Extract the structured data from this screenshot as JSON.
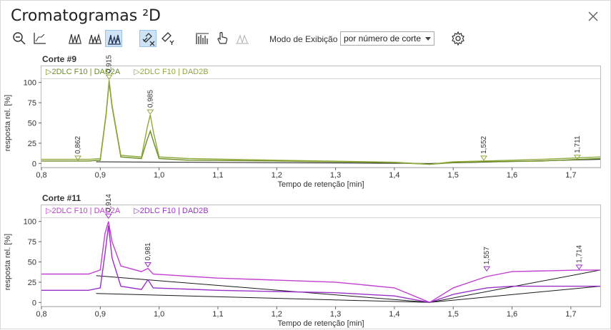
{
  "window": {
    "title": "Cromatogramas ²D"
  },
  "toolbar": {
    "mode_label": "Modo de Exibição",
    "mode_value": "por número de corte",
    "buttons": [
      {
        "name": "zoom-out-icon"
      },
      {
        "name": "axis-icon"
      },
      {
        "name": "peaks-icon"
      },
      {
        "name": "peaks-alt-icon"
      },
      {
        "name": "peaks-overlay-icon",
        "active": true
      },
      {
        "name": "link-x-icon",
        "active": true
      },
      {
        "name": "link-y-icon"
      },
      {
        "name": "spectrum-icon"
      },
      {
        "name": "hand-pointer-icon"
      },
      {
        "name": "peak-disabled-icon"
      },
      {
        "name": "gear-icon"
      }
    ]
  },
  "colors": {
    "corte9_a": "#6b8e23",
    "corte9_b": "#8fa83a",
    "corte11_a": "#c040d0",
    "corte11_b": "#9a30c8",
    "baseline": "#1a1a1a"
  },
  "panels": [
    {
      "title": "Corte #9",
      "legend": [
        "▷2DLC F10 | DAD2A",
        "▷2DLC F10 | DAD2B"
      ],
      "xlabel": "Tempo de retenção [min]",
      "ylabel": "resposta rel. [%]"
    },
    {
      "title": "Corte #11",
      "legend": [
        "▷2DLC F10 | DAD2A",
        "▷2DLC F10 | DAD2B"
      ],
      "xlabel": "Tempo de retenção [min]",
      "ylabel": "resposta rel. [%]"
    }
  ],
  "chart_data": [
    {
      "type": "line",
      "title": "Corte #9",
      "xlabel": "Tempo de retenção [min]",
      "ylabel": "resposta rel. [%]",
      "xlim": [
        0.8,
        1.75
      ],
      "ylim": [
        -5,
        105
      ],
      "x_ticks": [
        "0,8",
        "0,9",
        "1,0",
        "1,1",
        "1,2",
        "1,3",
        "1,4",
        "1,5",
        "1,6",
        "1,7"
      ],
      "y_ticks": [
        "0",
        "25",
        "50",
        "75",
        "100"
      ],
      "peaks": [
        {
          "x": 0.862,
          "label": "0,862",
          "y": 3
        },
        {
          "x": 0.915,
          "label": "0,915",
          "y": 103
        },
        {
          "x": 0.985,
          "label": "0,985",
          "y": 60
        },
        {
          "x": 1.552,
          "label": "1,552",
          "y": 3
        },
        {
          "x": 1.711,
          "label": "1,711",
          "y": 4
        }
      ],
      "series": [
        {
          "name": "2DLC F10 | DAD2A",
          "points": [
            [
              0.8,
              3
            ],
            [
              0.88,
              3
            ],
            [
              0.9,
              4
            ],
            [
              0.91,
              60
            ],
            [
              0.915,
              100
            ],
            [
              0.92,
              70
            ],
            [
              0.935,
              8
            ],
            [
              0.97,
              6
            ],
            [
              0.98,
              30
            ],
            [
              0.985,
              40
            ],
            [
              0.99,
              28
            ],
            [
              1.0,
              6
            ],
            [
              1.05,
              4
            ],
            [
              1.2,
              3
            ],
            [
              1.4,
              1
            ],
            [
              1.46,
              -1
            ],
            [
              1.5,
              1
            ],
            [
              1.55,
              2
            ],
            [
              1.65,
              3
            ],
            [
              1.75,
              6
            ]
          ]
        },
        {
          "name": "2DLC F10 | DAD2B",
          "points": [
            [
              0.8,
              5
            ],
            [
              0.88,
              5
            ],
            [
              0.9,
              6
            ],
            [
              0.91,
              62
            ],
            [
              0.915,
              103
            ],
            [
              0.92,
              72
            ],
            [
              0.935,
              10
            ],
            [
              0.97,
              8
            ],
            [
              0.98,
              45
            ],
            [
              0.985,
              60
            ],
            [
              0.99,
              40
            ],
            [
              1.0,
              8
            ],
            [
              1.05,
              6
            ],
            [
              1.2,
              4
            ],
            [
              1.4,
              1.5
            ],
            [
              1.46,
              -1
            ],
            [
              1.5,
              2
            ],
            [
              1.55,
              3
            ],
            [
              1.65,
              5
            ],
            [
              1.75,
              8
            ]
          ]
        }
      ]
    },
    {
      "type": "line",
      "title": "Corte #11",
      "xlabel": "Tempo de retenção [min]",
      "ylabel": "resposta rel. [%]",
      "xlim": [
        0.8,
        1.75
      ],
      "ylim": [
        -5,
        105
      ],
      "x_ticks": [
        "0,8",
        "0,9",
        "1,0",
        "1,1",
        "1,2",
        "1,3",
        "1,4",
        "1,5",
        "1,6",
        "1,7"
      ],
      "y_ticks": [
        "0",
        "25",
        "50",
        "75",
        "100"
      ],
      "peaks": [
        {
          "x": 0.914,
          "label": "0,914",
          "y": 103
        },
        {
          "x": 0.981,
          "label": "0,981",
          "y": 43
        },
        {
          "x": 1.557,
          "label": "1,557",
          "y": 38
        },
        {
          "x": 1.714,
          "label": "1,714",
          "y": 40
        }
      ],
      "series": [
        {
          "name": "2DLC F10 | DAD2A",
          "points": [
            [
              0.8,
              35
            ],
            [
              0.88,
              35
            ],
            [
              0.9,
              40
            ],
            [
              0.908,
              85
            ],
            [
              0.914,
              100
            ],
            [
              0.92,
              75
            ],
            [
              0.935,
              45
            ],
            [
              0.97,
              38
            ],
            [
              0.981,
              42
            ],
            [
              0.99,
              35
            ],
            [
              1.1,
              30
            ],
            [
              1.3,
              25
            ],
            [
              1.4,
              18
            ],
            [
              1.46,
              0
            ],
            [
              1.5,
              18
            ],
            [
              1.557,
              32
            ],
            [
              1.6,
              38
            ],
            [
              1.714,
              40
            ],
            [
              1.75,
              40
            ]
          ]
        },
        {
          "name": "2DLC F10 | DAD2B",
          "points": [
            [
              0.8,
              15
            ],
            [
              0.88,
              15
            ],
            [
              0.9,
              18
            ],
            [
              0.908,
              60
            ],
            [
              0.914,
              95
            ],
            [
              0.92,
              55
            ],
            [
              0.935,
              20
            ],
            [
              0.97,
              16
            ],
            [
              0.981,
              28
            ],
            [
              0.99,
              18
            ],
            [
              1.1,
              15
            ],
            [
              1.3,
              12
            ],
            [
              1.4,
              8
            ],
            [
              1.46,
              0
            ],
            [
              1.5,
              10
            ],
            [
              1.557,
              18
            ],
            [
              1.6,
              20
            ],
            [
              1.714,
              20
            ],
            [
              1.75,
              20
            ]
          ]
        }
      ],
      "baselines": [
        [
          [
            0.893,
            33
          ],
          [
            1.46,
            0
          ],
          [
            1.75,
            40
          ]
        ],
        [
          [
            0.893,
            11
          ],
          [
            1.46,
            0
          ],
          [
            1.75,
            20
          ]
        ]
      ]
    }
  ]
}
